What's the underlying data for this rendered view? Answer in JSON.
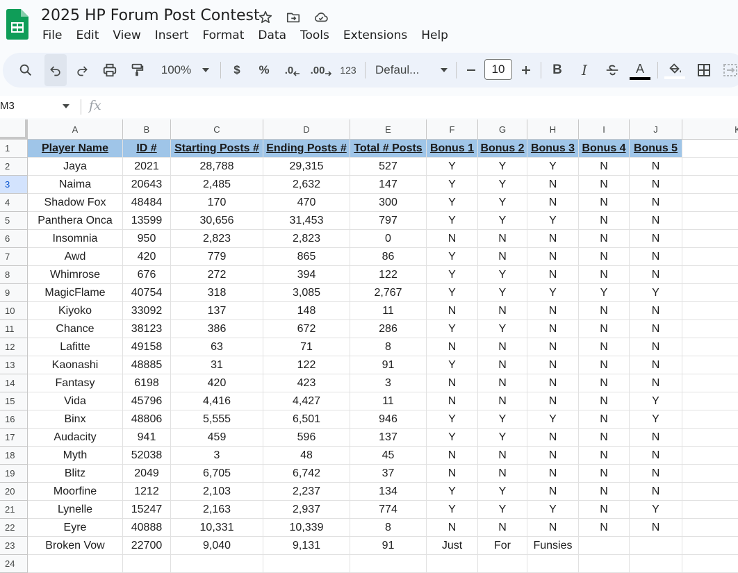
{
  "app": {
    "title": "2025 HP Forum Post Contest",
    "menu": [
      "File",
      "Edit",
      "View",
      "Insert",
      "Format",
      "Data",
      "Tools",
      "Extensions",
      "Help"
    ]
  },
  "toolbar": {
    "zoom": "100%",
    "currency": "$",
    "percent": "%",
    "dec_decrease": ".0",
    "dec_increase": ".00",
    "number_format": "123",
    "font": "Defaul...",
    "font_size": "10",
    "bold": "B",
    "italic": "I",
    "text_color_letter": "A"
  },
  "formula": {
    "name_box": "M3",
    "fx": "fx"
  },
  "columns": [
    "A",
    "B",
    "C",
    "D",
    "E",
    "F",
    "G",
    "H",
    "I",
    "J",
    "K"
  ],
  "header_row": [
    "Player Name",
    "ID #",
    "Starting Posts #",
    "Ending Posts #",
    "Total # Posts",
    "Bonus 1",
    "Bonus 2",
    "Bonus 3",
    "Bonus 4",
    "Bonus 5"
  ],
  "rows": [
    [
      "Jaya",
      "2021",
      "28,788",
      "29,315",
      "527",
      "Y",
      "Y",
      "Y",
      "N",
      "N"
    ],
    [
      "Naima",
      "20643",
      "2,485",
      "2,632",
      "147",
      "Y",
      "Y",
      "N",
      "N",
      "N"
    ],
    [
      "Shadow Fox",
      "48484",
      "170",
      "470",
      "300",
      "Y",
      "Y",
      "N",
      "N",
      "N"
    ],
    [
      "Panthera Onca",
      "13599",
      "30,656",
      "31,453",
      "797",
      "Y",
      "Y",
      "Y",
      "N",
      "N"
    ],
    [
      "Insomnia",
      "950",
      "2,823",
      "2,823",
      "0",
      "N",
      "N",
      "N",
      "N",
      "N"
    ],
    [
      "Awd",
      "420",
      "779",
      "865",
      "86",
      "Y",
      "N",
      "N",
      "N",
      "N"
    ],
    [
      "Whimrose",
      "676",
      "272",
      "394",
      "122",
      "Y",
      "Y",
      "N",
      "N",
      "N"
    ],
    [
      "MagicFlame",
      "40754",
      "318",
      "3,085",
      "2,767",
      "Y",
      "Y",
      "Y",
      "Y",
      "Y"
    ],
    [
      "Kiyoko",
      "33092",
      "137",
      "148",
      "11",
      "N",
      "N",
      "N",
      "N",
      "N"
    ],
    [
      "Chance",
      "38123",
      "386",
      "672",
      "286",
      "Y",
      "Y",
      "N",
      "N",
      "N"
    ],
    [
      "Lafitte",
      "49158",
      "63",
      "71",
      "8",
      "N",
      "N",
      "N",
      "N",
      "N"
    ],
    [
      "Kaonashi",
      "48885",
      "31",
      "122",
      "91",
      "Y",
      "N",
      "N",
      "N",
      "N"
    ],
    [
      "Fantasy",
      "6198",
      "420",
      "423",
      "3",
      "N",
      "N",
      "N",
      "N",
      "N"
    ],
    [
      "Vida",
      "45796",
      "4,416",
      "4,427",
      "11",
      "N",
      "N",
      "N",
      "N",
      "Y"
    ],
    [
      "Binx",
      "48806",
      "5,555",
      "6,501",
      "946",
      "Y",
      "Y",
      "Y",
      "N",
      "Y"
    ],
    [
      "Audacity",
      "941",
      "459",
      "596",
      "137",
      "Y",
      "Y",
      "N",
      "N",
      "N"
    ],
    [
      "Myth",
      "52038",
      "3",
      "48",
      "45",
      "N",
      "N",
      "N",
      "N",
      "N"
    ],
    [
      "Blitz",
      "2049",
      "6,705",
      "6,742",
      "37",
      "N",
      "N",
      "N",
      "N",
      "N"
    ],
    [
      "Moorfine",
      "1212",
      "2,103",
      "2,237",
      "134",
      "Y",
      "Y",
      "N",
      "N",
      "N"
    ],
    [
      "Lynelle",
      "15247",
      "2,163",
      "2,937",
      "774",
      "Y",
      "Y",
      "Y",
      "N",
      "Y"
    ],
    [
      "Eyre",
      "40888",
      "10,331",
      "10,339",
      "8",
      "N",
      "N",
      "N",
      "N",
      "N"
    ],
    [
      "Broken Vow",
      "22700",
      "9,040",
      "9,131",
      "91",
      "Just",
      "For",
      "Funsies",
      "",
      ""
    ],
    [
      "",
      "",
      "",
      "",
      "",
      "",
      "",
      "",
      "",
      ""
    ]
  ],
  "selected_row": "3",
  "colors": {
    "header_fill": "#9fc5e8",
    "selection": "#1a73e8",
    "toolbar_bg": "#edf2fa"
  }
}
